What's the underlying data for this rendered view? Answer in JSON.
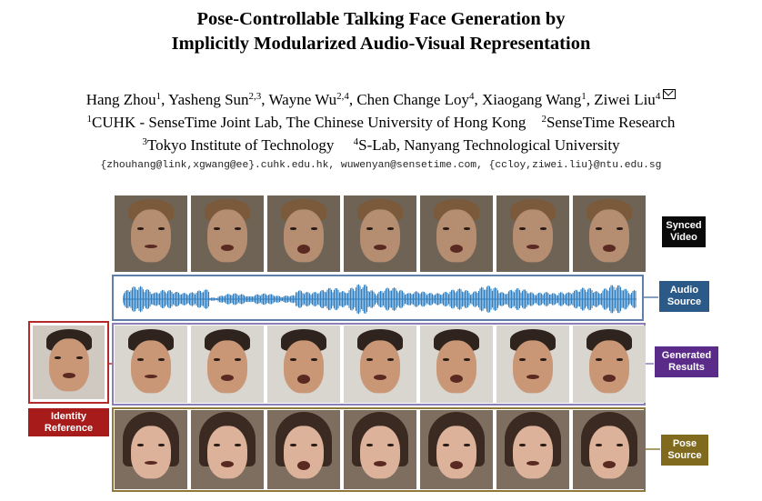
{
  "paper": {
    "title_line1": "Pose-Controllable Talking Face Generation by",
    "title_line2": "Implicitly Modularized Audio-Visual Representation",
    "authors": [
      {
        "name": "Hang Zhou",
        "sup": "1"
      },
      {
        "name": "Yasheng Sun",
        "sup": "2,3"
      },
      {
        "name": "Wayne Wu",
        "sup": "2,4"
      },
      {
        "name": "Chen Change Loy",
        "sup": "4"
      },
      {
        "name": "Xiaogang Wang",
        "sup": "1"
      },
      {
        "name": "Ziwei Liu",
        "sup": "4"
      }
    ],
    "affiliations": [
      {
        "sup": "1",
        "name": "CUHK - SenseTime Joint Lab, The Chinese University of Hong Kong"
      },
      {
        "sup": "2",
        "name": "SenseTime Research"
      },
      {
        "sup": "3",
        "name": "Tokyo Institute of Technology"
      },
      {
        "sup": "4",
        "name": "S-Lab, Nanyang Technological University"
      }
    ],
    "emails": "{zhouhang@link,xgwang@ee}.cuhk.edu.hk, wuwenyan@sensetime.com, {ccloy,ziwei.liu}@ntu.edu.sg"
  },
  "figure": {
    "labels": {
      "synced_line1": "Synced",
      "synced_line2": "Video",
      "audio_line1": "Audio",
      "audio_line2": "Source",
      "generated_line1": "Generated",
      "generated_line2": "Results",
      "identity_line1": "Identity",
      "identity_line2": "Reference",
      "pose_line1": "Pose",
      "pose_line2": "Source"
    },
    "colors": {
      "synced": "#0a0a0a",
      "audio": "#2c5a88",
      "generated": "#5b2b8a",
      "identity": "#a81b1b",
      "pose": "#806a1d",
      "waveform": "#2f7fc0"
    }
  }
}
